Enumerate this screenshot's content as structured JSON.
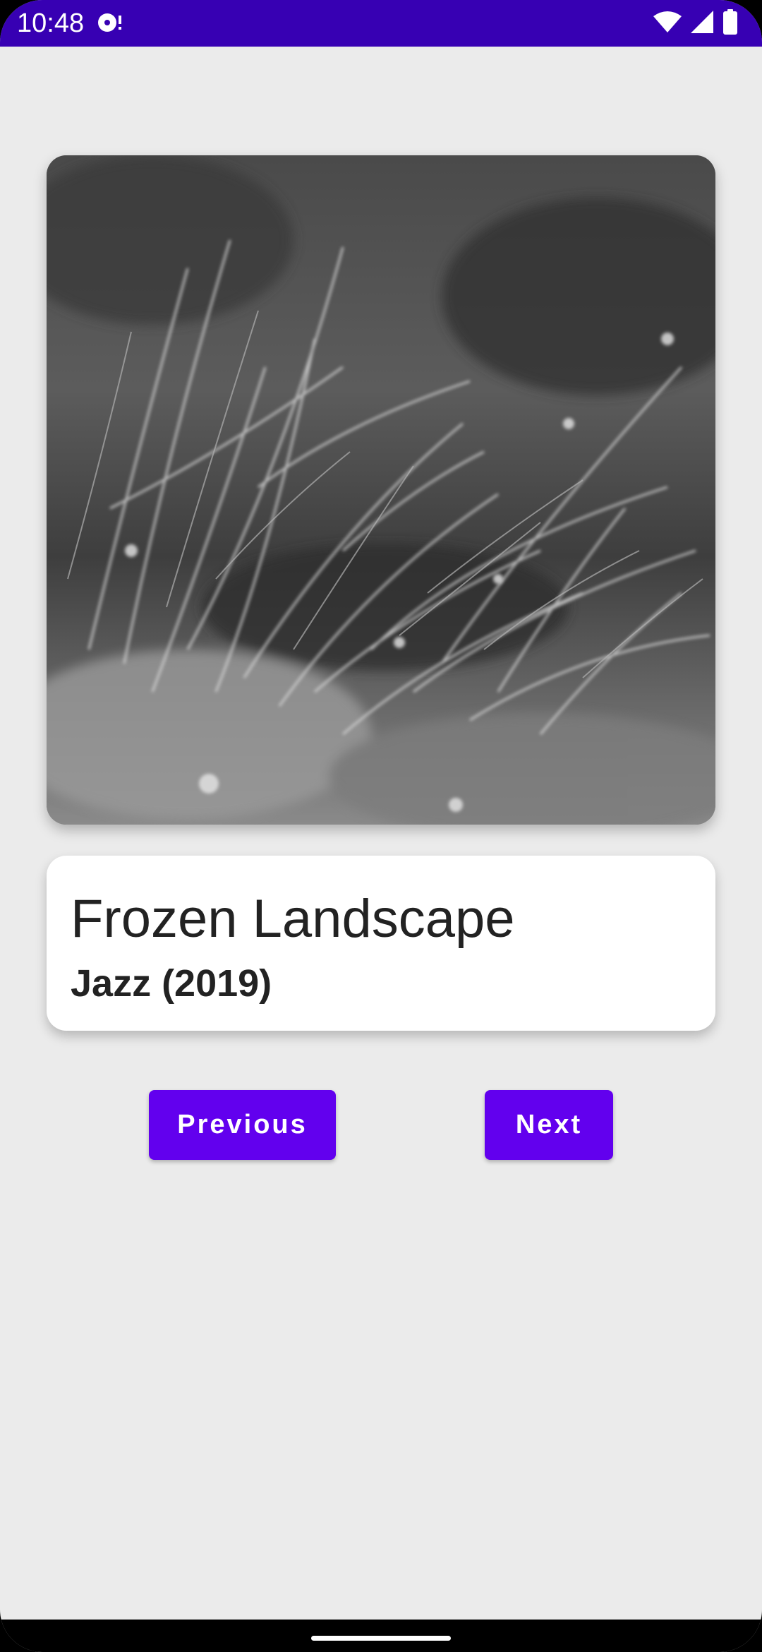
{
  "status_bar": {
    "time": "10:48",
    "background": "#3700b3",
    "icons": [
      "media-notification-icon",
      "wifi-icon",
      "cellular-signal-icon",
      "battery-icon"
    ]
  },
  "player": {
    "album_art": {
      "icon": "grass-photo-artwork",
      "style": "grayscale photo of grass"
    },
    "track_title": "Frozen Landscape",
    "track_subtitle": "Jazz (2019)"
  },
  "controls": {
    "previous_label": "Previous",
    "next_label": "Next",
    "button_color": "#6200ee"
  },
  "navigation": {
    "home_indicator": "gesture-handle"
  },
  "colors": {
    "background": "#ebebeb",
    "card": "#ffffff",
    "text": "#222222"
  }
}
